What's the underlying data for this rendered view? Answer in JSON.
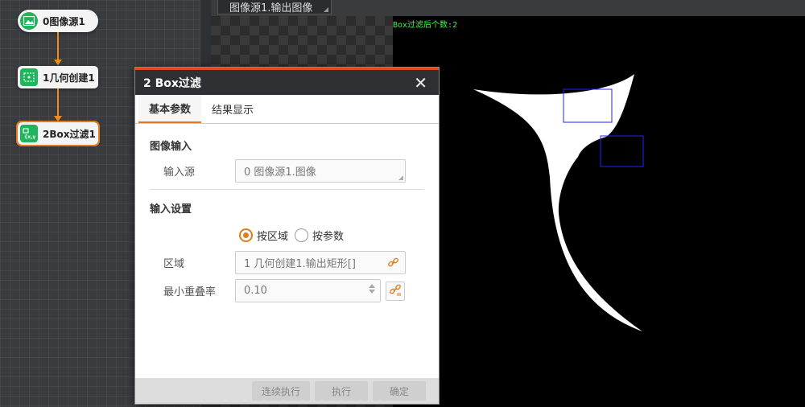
{
  "flow": {
    "nodes": [
      {
        "label": "0图像源1",
        "icon": "image-icon"
      },
      {
        "label": "1几何创建1",
        "icon": "geometry-create-icon"
      },
      {
        "label": "2Box过滤1",
        "icon": "box-filter-icon"
      }
    ],
    "link_color": "#f08a1c",
    "node_icon_color": "#1fb55d"
  },
  "viewer": {
    "tab_label": "图像源1.输出图像",
    "overlay_text": "Box过滤后个数:2",
    "overlay_color": "#33ff44",
    "box_color": "#2222ff"
  },
  "dialog": {
    "title": "2 Box过滤",
    "close_glyph": "✕",
    "tabs": [
      "基本参数",
      "结果显示"
    ],
    "active_tab": 0,
    "accent_color": "#e37a1c",
    "image_input": {
      "section_title": "图像输入",
      "source_label": "输入源",
      "source_value": "0 图像源1.图像"
    },
    "input_settings": {
      "section_title": "输入设置",
      "radio_by_region": "按区域",
      "radio_by_param": "按参数",
      "selected": "按区域",
      "region_label": "区域",
      "region_value": "1 几何创建1.输出矩形[]",
      "overlap_label": "最小重叠率",
      "overlap_value": "0.10"
    },
    "footer": {
      "continuous_run": "连续执行",
      "run": "执行",
      "confirm": "确定"
    }
  }
}
